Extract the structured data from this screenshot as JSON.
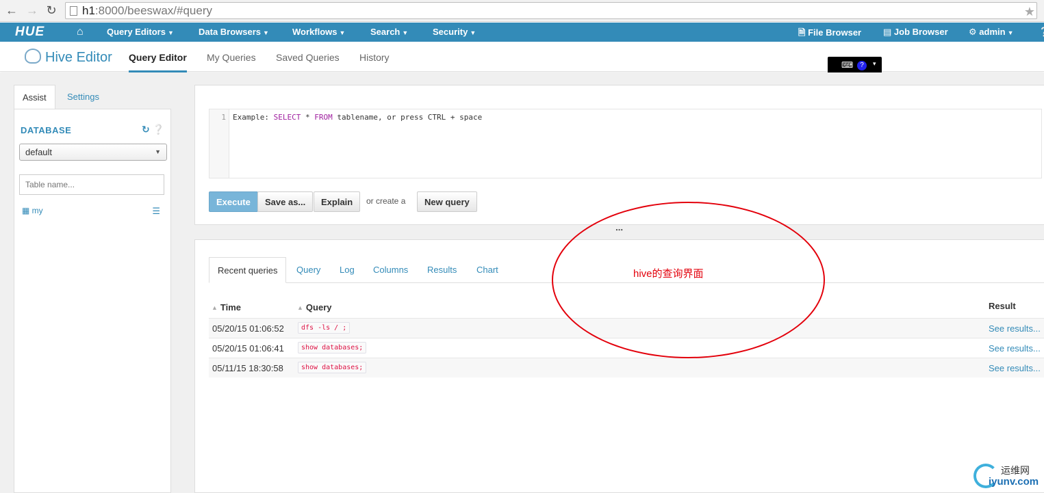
{
  "browser": {
    "url_host": "h1",
    "url_rest": ":8000/beeswax/#query"
  },
  "navbar": {
    "logo": "HUE",
    "items": [
      {
        "label": "Query Editors"
      },
      {
        "label": "Data Browsers"
      },
      {
        "label": "Workflows"
      },
      {
        "label": "Search"
      },
      {
        "label": "Security"
      }
    ],
    "right": {
      "file_browser": "File Browser",
      "job_browser": "Job Browser",
      "user": "admin"
    }
  },
  "subnav": {
    "app_title": "Hive Editor",
    "links": [
      "Query Editor",
      "My Queries",
      "Saved Queries",
      "History"
    ]
  },
  "assist": {
    "tabs": [
      "Assist",
      "Settings"
    ],
    "database_title": "DATABASE",
    "database_selected": "default",
    "table_placeholder": "Table name...",
    "tables": [
      "my"
    ]
  },
  "editor": {
    "line_number": "1",
    "code_prefix": "Example: ",
    "code_kw1": "SELECT",
    "code_mid": " * ",
    "code_kw2": "FROM",
    "code_suffix": " tablename, or press CTRL + space",
    "buttons": {
      "execute": "Execute",
      "save_as": "Save as...",
      "explain": "Explain",
      "or_create": "or create a",
      "new_query": "New query"
    }
  },
  "results": {
    "tabs": [
      "Recent queries",
      "Query",
      "Log",
      "Columns",
      "Results",
      "Chart"
    ],
    "headers": {
      "time": "Time",
      "query": "Query",
      "result": "Result"
    },
    "rows": [
      {
        "time": "05/20/15 01:06:52",
        "query": "dfs -ls / ;",
        "result": "See results..."
      },
      {
        "time": "05/20/15 01:06:41",
        "query": "show databases;",
        "result": "See results..."
      },
      {
        "time": "05/11/15 18:30:58",
        "query": "show databases;",
        "result": "See results..."
      }
    ]
  },
  "annotation": {
    "text": "hive的查询界面",
    "color": "#e3000b"
  },
  "watermark": {
    "cn": "运维网",
    "en": "iyunv.com"
  },
  "colors": {
    "accent": "#338bb8",
    "execute_button": "#78b5d9"
  }
}
